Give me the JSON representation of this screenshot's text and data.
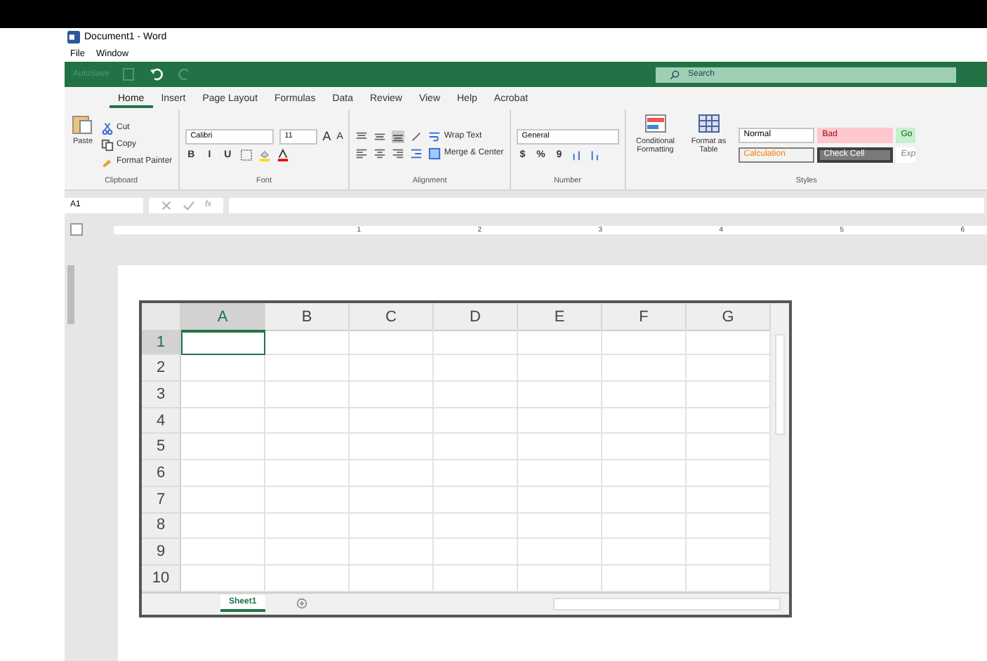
{
  "window": {
    "title": "Document1 - Word"
  },
  "menu": [
    "File",
    "Window"
  ],
  "quick_access": {
    "autosave": "AutoSave",
    "search_placeholder": "Search"
  },
  "tabs": [
    {
      "label": "Home",
      "selected": true
    },
    {
      "label": "Insert",
      "selected": false
    },
    {
      "label": "Page Layout",
      "selected": false
    },
    {
      "label": "Formulas",
      "selected": false
    },
    {
      "label": "Data",
      "selected": false
    },
    {
      "label": "Review",
      "selected": false
    },
    {
      "label": "View",
      "selected": false
    },
    {
      "label": "Help",
      "selected": false
    },
    {
      "label": "Acrobat",
      "selected": false
    }
  ],
  "ribbon": {
    "clipboard": {
      "paste": "Paste",
      "cut": "Cut",
      "copy": "Copy",
      "painter": "Format Painter",
      "label": "Clipboard"
    },
    "font": {
      "name": "Calibri",
      "size": "11",
      "grow": "A",
      "shrink": "A",
      "bold": "B",
      "italic": "I",
      "underline": "U",
      "label": "Font"
    },
    "alignment": {
      "wrap": "Wrap Text",
      "merge": "Merge & Center",
      "label": "Alignment"
    },
    "number": {
      "format": "General",
      "currency": "$",
      "percent": "%",
      "comma": "9",
      "label": "Number"
    },
    "styles": {
      "conditional": "Conditional Formatting",
      "table": "Format as Table",
      "label": "Styles",
      "cells": [
        {
          "label": "Normal",
          "kind": "normal"
        },
        {
          "label": "Bad",
          "kind": "bad"
        },
        {
          "label": "Go",
          "kind": "good"
        },
        {
          "label": "Calculation",
          "kind": "calc"
        },
        {
          "label": "Check Cell",
          "kind": "check"
        },
        {
          "label": "Exp",
          "kind": "note"
        }
      ]
    }
  },
  "formula_bar": {
    "name_box": "A1",
    "fx": "fx"
  },
  "ruler": [
    "1",
    "2",
    "3",
    "4",
    "5",
    "6"
  ],
  "sheet": {
    "columns": [
      {
        "label": "A",
        "selected": true
      },
      {
        "label": "B",
        "selected": false
      },
      {
        "label": "C",
        "selected": false
      },
      {
        "label": "D",
        "selected": false
      },
      {
        "label": "E",
        "selected": false
      },
      {
        "label": "F",
        "selected": false
      },
      {
        "label": "G",
        "selected": false
      }
    ],
    "rows": [
      {
        "label": "1",
        "selected": true
      },
      {
        "label": "2",
        "selected": false
      },
      {
        "label": "3",
        "selected": false
      },
      {
        "label": "4",
        "selected": false
      },
      {
        "label": "5",
        "selected": false
      },
      {
        "label": "6",
        "selected": false
      },
      {
        "label": "7",
        "selected": false
      },
      {
        "label": "8",
        "selected": false
      },
      {
        "label": "9",
        "selected": false
      },
      {
        "label": "10",
        "selected": false
      }
    ],
    "tabs": [
      {
        "label": "Sheet1",
        "selected": true
      }
    ]
  }
}
